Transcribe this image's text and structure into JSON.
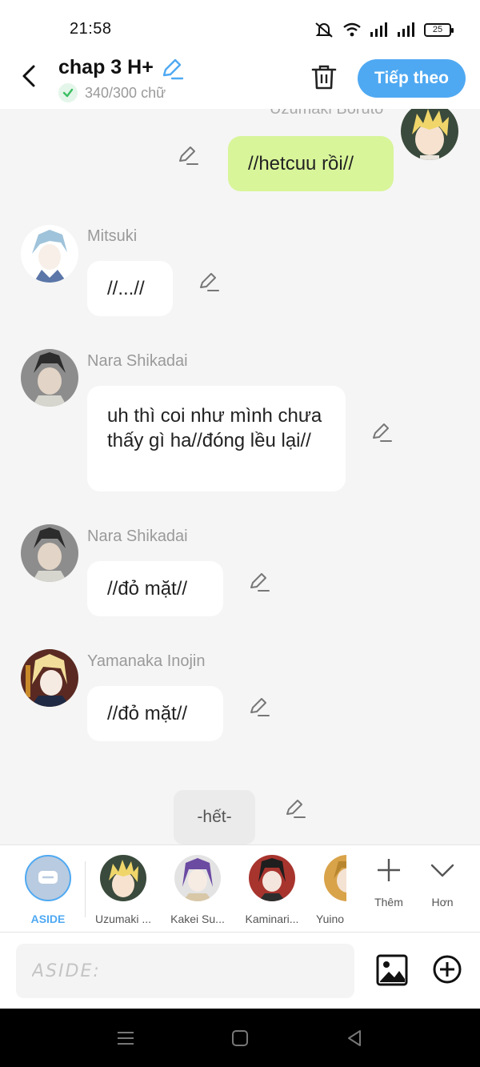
{
  "status_bar": {
    "time": "21:58",
    "battery": "25"
  },
  "header": {
    "title": "chap 3 H+",
    "word_count": "340/300 chữ",
    "next_label": "Tiếp theo"
  },
  "chat": {
    "first_sender": "Uzumaki Boruto",
    "messages": [
      {
        "sender": "Uzumaki Boruto",
        "text": "//hetcuu rồi//",
        "own": true
      },
      {
        "sender": "Mitsuki",
        "text": "//...//"
      },
      {
        "sender": "Nara Shikadai",
        "text": "uh thì coi như mình chưa thấy gì ha//đóng lều lại//"
      },
      {
        "sender": "Nara Shikadai",
        "text": "//đỏ mặt//"
      },
      {
        "sender": "Yamanaka Inojin",
        "text": "//đỏ mặt//"
      }
    ],
    "end_label": "-hết-"
  },
  "characters": {
    "aside": "ASIDE",
    "items": [
      "Uzumaki ...",
      "Kakei Su...",
      "Kaminari...",
      "Yuino"
    ],
    "add_label": "Thêm",
    "more_label": "Hơn"
  },
  "input": {
    "placeholder": "ASIDE:"
  },
  "colors": {
    "accent": "#4fa9f2",
    "own_bubble": "#d8f59a",
    "background": "#f5f5f5"
  }
}
